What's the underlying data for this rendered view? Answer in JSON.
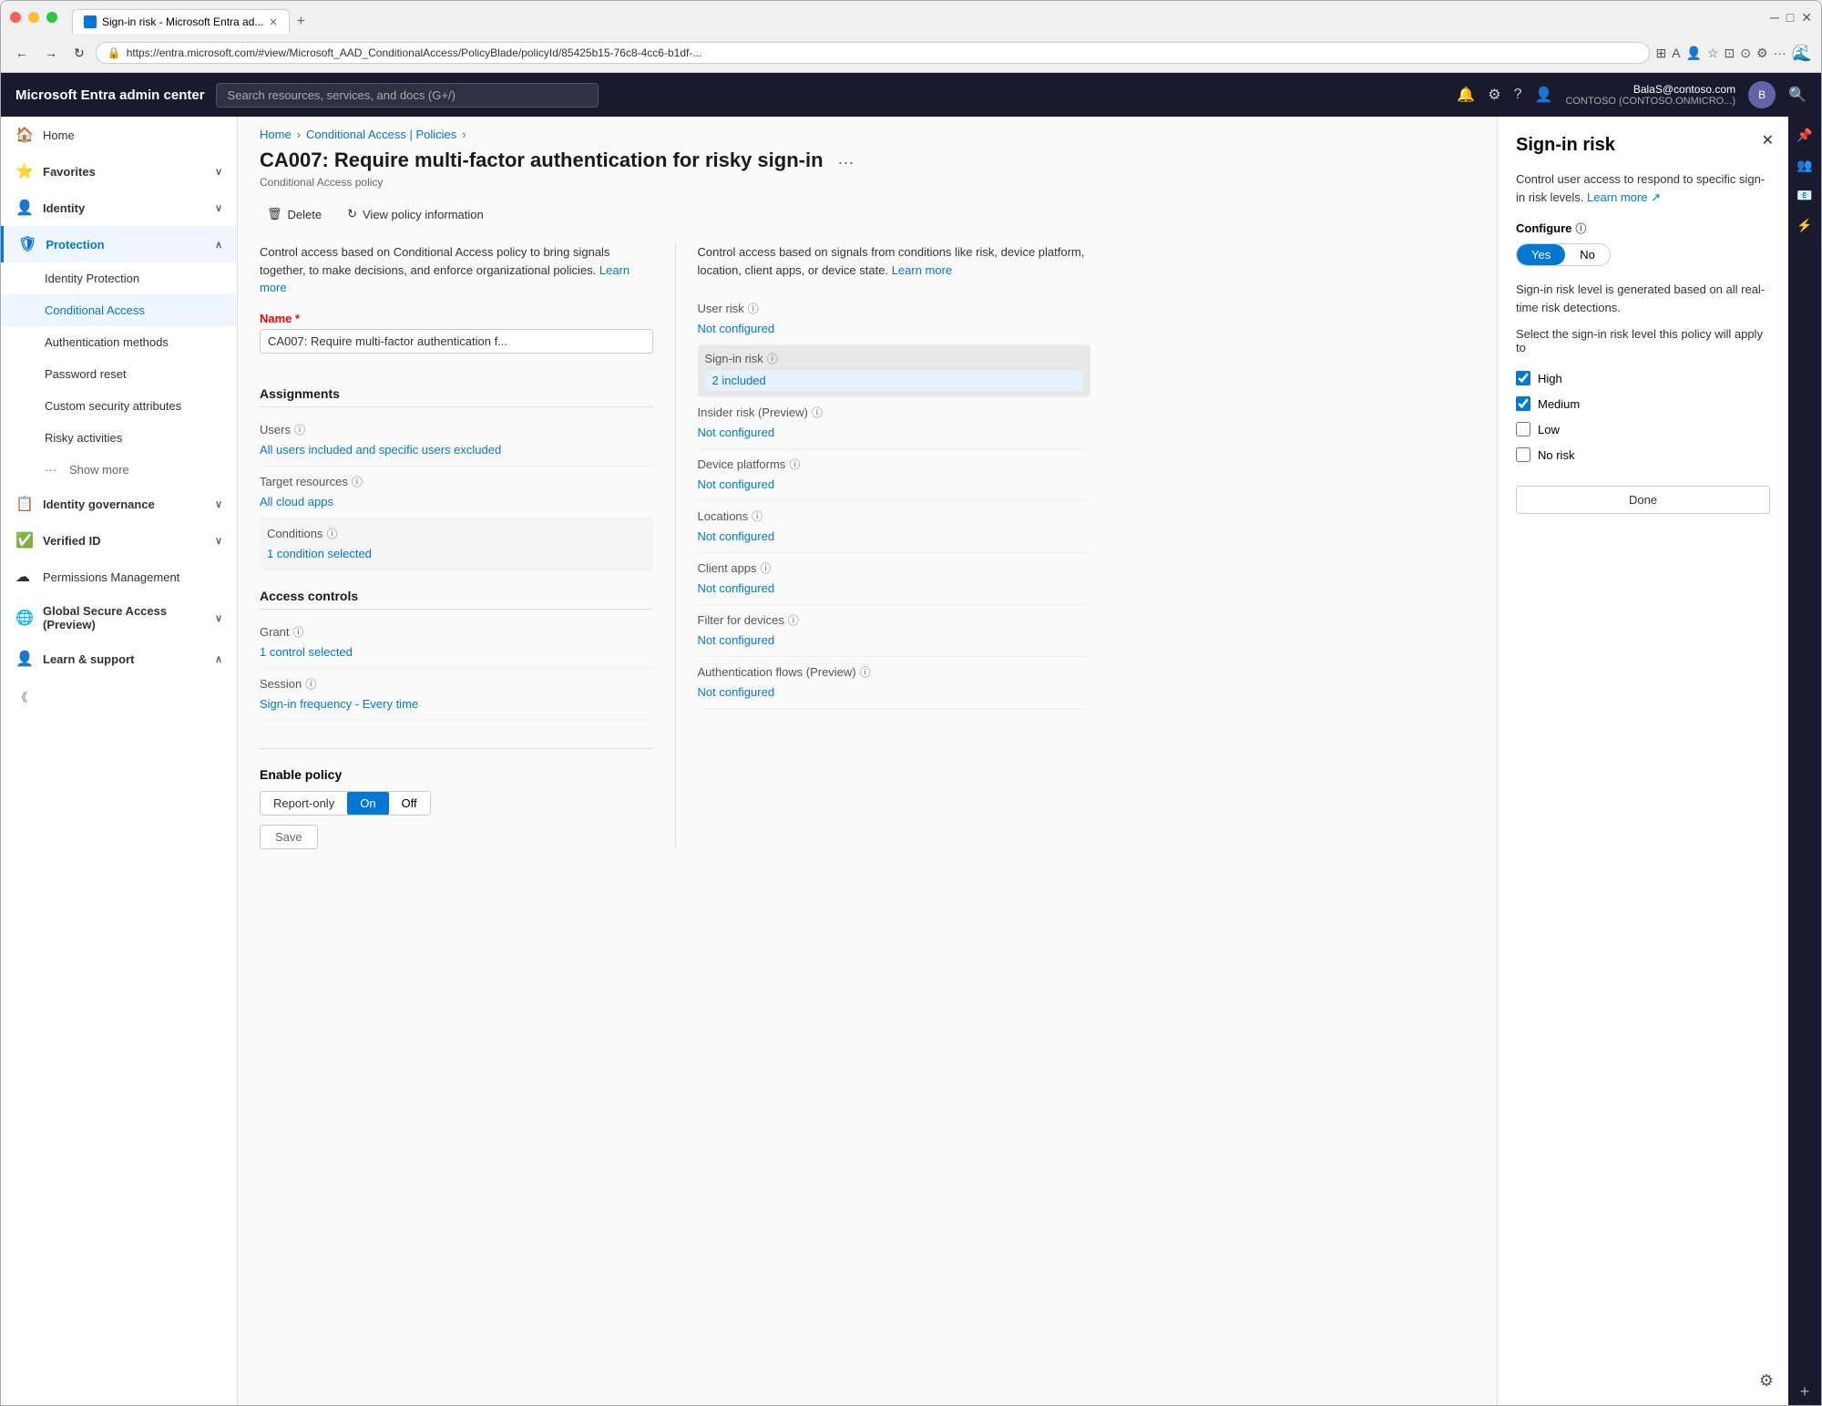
{
  "browser": {
    "url": "https://entra.microsoft.com/#view/Microsoft_AAD_ConditionalAccess/PolicyBlade/policyId/85425b15-76c8-4cc6-b1df-...",
    "tab_title": "Sign-in risk - Microsoft Entra ad...",
    "new_tab_icon": "+",
    "nav": {
      "back": "←",
      "forward": "→",
      "refresh": "↻",
      "home": "⌂"
    }
  },
  "app": {
    "title": "Microsoft Entra admin center",
    "search_placeholder": "Search resources, services, and docs (G+/)",
    "user": {
      "email": "BalaS@contoso.com",
      "tenant": "CONTOSO (CONTOSO.ONMICRO...)",
      "avatar_initials": "B"
    }
  },
  "sidebar": {
    "items": [
      {
        "id": "home",
        "label": "Home",
        "icon": "🏠",
        "has_chevron": false
      },
      {
        "id": "favorites",
        "label": "Favorites",
        "icon": "⭐",
        "has_chevron": true
      },
      {
        "id": "identity",
        "label": "Identity",
        "icon": "👤",
        "has_chevron": true
      },
      {
        "id": "protection",
        "label": "Protection",
        "icon": "🛡",
        "has_chevron": true,
        "active": true
      },
      {
        "id": "identity-protection",
        "label": "Identity Protection",
        "is_sub": true
      },
      {
        "id": "conditional-access",
        "label": "Conditional Access",
        "is_sub": true,
        "active_sub": true
      },
      {
        "id": "auth-methods",
        "label": "Authentication methods",
        "is_sub": true
      },
      {
        "id": "password-reset",
        "label": "Password reset",
        "is_sub": true
      },
      {
        "id": "custom-security",
        "label": "Custom security attributes",
        "is_sub": true
      },
      {
        "id": "risky-activities",
        "label": "Risky activities",
        "is_sub": true
      },
      {
        "id": "show-more",
        "label": "Show more",
        "is_sub": true,
        "icon": "···"
      },
      {
        "id": "identity-governance",
        "label": "Identity governance",
        "icon": "📋",
        "has_chevron": true
      },
      {
        "id": "verified-id",
        "label": "Verified ID",
        "icon": "✅",
        "has_chevron": true
      },
      {
        "id": "permissions-mgmt",
        "label": "Permissions Management",
        "icon": "☁",
        "has_chevron": false
      },
      {
        "id": "global-secure",
        "label": "Global Secure Access (Preview)",
        "icon": "🌐",
        "has_chevron": true
      },
      {
        "id": "learn-support",
        "label": "Learn & support",
        "icon": "👤",
        "has_chevron": true
      }
    ]
  },
  "breadcrumb": {
    "items": [
      "Home",
      "Conditional Access | Policies"
    ],
    "separators": [
      ">",
      ">"
    ]
  },
  "page": {
    "title": "CA007: Require multi-factor authentication for risky sign-in",
    "subtitle": "Conditional Access policy",
    "three_dots": "···",
    "toolbar": {
      "delete_label": "Delete",
      "view_policy_label": "View policy information"
    }
  },
  "left_column": {
    "description": "Control access based on Conditional Access policy to bring signals together, to make decisions, and enforce organizational policies.",
    "learn_more": "Learn more",
    "name_label": "Name",
    "name_required": "*",
    "name_value": "CA007: Require multi-factor authentication f...",
    "assignments_label": "Assignments",
    "users_label": "Users",
    "users_info": "ⓘ",
    "users_value": "All users included and specific users excluded",
    "target_resources_label": "Target resources",
    "target_resources_info": "ⓘ",
    "target_resources_value": "All cloud apps",
    "conditions_label": "Conditions",
    "conditions_info": "ⓘ",
    "conditions_value": "1 condition selected",
    "access_controls_label": "Access controls",
    "grant_label": "Grant",
    "grant_info": "ⓘ",
    "grant_value": "1 control selected",
    "session_label": "Session",
    "session_info": "ⓘ",
    "session_value": "Sign-in frequency - Every time"
  },
  "right_column": {
    "description": "Control access based on signals from conditions like risk, device platform, location, client apps, or device state.",
    "learn_more": "Learn more",
    "user_risk_label": "User risk",
    "user_risk_info": "ⓘ",
    "user_risk_value": "Not configured",
    "sign_in_risk_label": "Sign-in risk",
    "sign_in_risk_info": "ⓘ",
    "sign_in_risk_value": "2 included",
    "insider_risk_label": "Insider risk (Preview)",
    "insider_risk_info": "ⓘ",
    "insider_risk_value": "Not configured",
    "device_platforms_label": "Device platforms",
    "device_platforms_info": "ⓘ",
    "device_platforms_value": "Not configured",
    "locations_label": "Locations",
    "locations_info": "ⓘ",
    "locations_value": "Not configured",
    "client_apps_label": "Client apps",
    "client_apps_info": "ⓘ",
    "client_apps_value": "Not configured",
    "filter_devices_label": "Filter for devices",
    "filter_devices_info": "ⓘ",
    "filter_devices_value": "Not configured",
    "auth_flows_label": "Authentication flows (Preview)",
    "auth_flows_info": "ⓘ",
    "auth_flows_value": "Not configured"
  },
  "enable_policy": {
    "label": "Enable policy",
    "options": [
      "Report-only",
      "On",
      "Off"
    ],
    "active": "On"
  },
  "save_btn": "Save",
  "right_panel": {
    "title": "Sign-in risk",
    "close": "✕",
    "description": "Control user access to respond to specific sign-in risk levels.",
    "learn_more": "Learn more",
    "configure_label": "Configure",
    "configure_info": "ⓘ",
    "yes_label": "Yes",
    "no_label": "No",
    "active_toggle": "Yes",
    "info_text": "Sign-in risk level is generated based on all real-time risk detections.",
    "select_label": "Select the sign-in risk level this policy will apply to",
    "checkboxes": [
      {
        "id": "high",
        "label": "High",
        "checked": true
      },
      {
        "id": "medium",
        "label": "Medium",
        "checked": true
      },
      {
        "id": "low",
        "label": "Low",
        "checked": false
      },
      {
        "id": "no-risk",
        "label": "No risk",
        "checked": false
      }
    ],
    "done_label": "Done"
  },
  "far_right": {
    "icons": [
      "📌",
      "👥",
      "📧",
      "⚡",
      "+"
    ]
  }
}
